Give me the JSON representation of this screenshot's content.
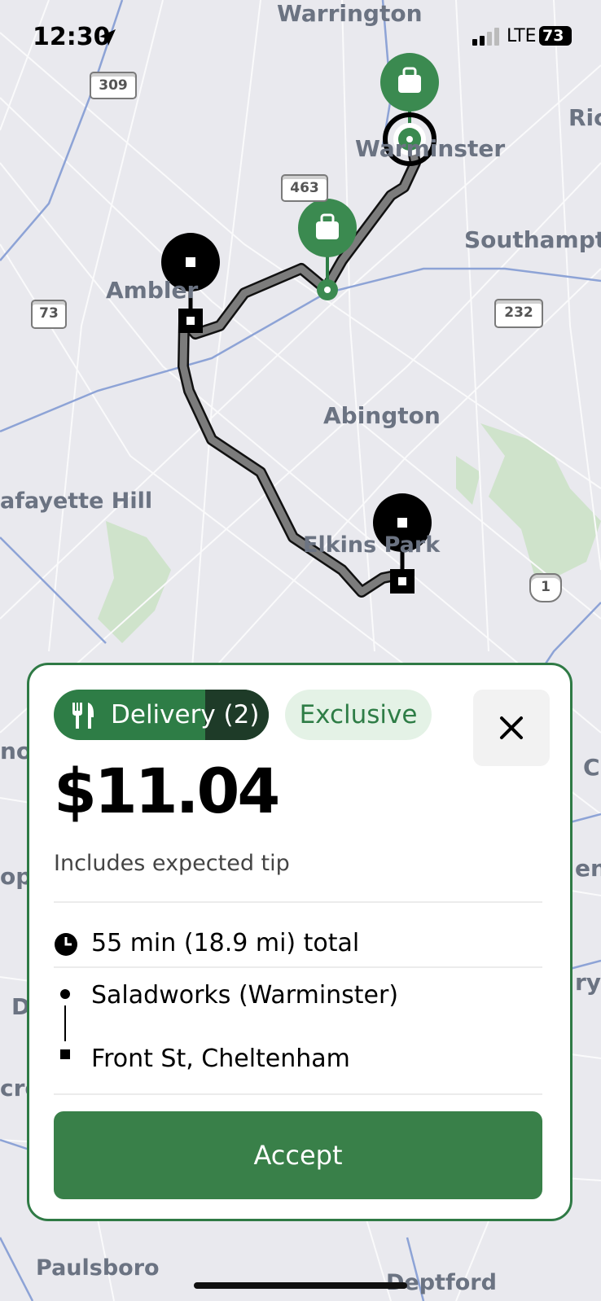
{
  "status_bar": {
    "time": "12:30",
    "network": "LTE",
    "battery": "73"
  },
  "map": {
    "places": [
      "Warrington",
      "Warminster",
      "Southampt",
      "Ambler",
      "Abington",
      "afayette Hill",
      "Elkins Park",
      "Paulsboro",
      "Deptford",
      "Ric",
      "C",
      "en",
      "ry",
      "D",
      "cro",
      "ope",
      "no"
    ],
    "shields": [
      "309",
      "463",
      "73",
      "232",
      "1"
    ]
  },
  "offer": {
    "delivery_label": "Delivery (2)",
    "exclusive_label": "Exclusive",
    "price": "$11.04",
    "tip_note": "Includes expected tip",
    "duration": "55 min (18.9 mi) total",
    "pickup": "Saladworks (Warminster)",
    "dropoff": "Front St, Cheltenham",
    "accept_label": "Accept"
  },
  "colors": {
    "brand_green": "#2e7d46",
    "dark_green": "#1e3b28",
    "exclusive_bg": "#e4f2e6"
  },
  "icons": [
    "navigation-arrow-icon",
    "signal-icon",
    "battery-icon",
    "utensils-icon",
    "close-icon",
    "clock-icon",
    "pickup-dot-icon",
    "dropoff-square-icon",
    "bag-icon"
  ]
}
